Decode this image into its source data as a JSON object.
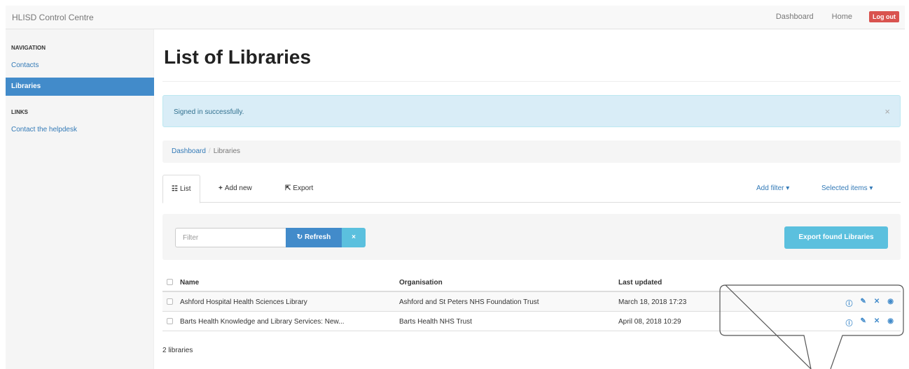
{
  "navbar": {
    "brand": "HLISD Control Centre",
    "links": [
      "Dashboard",
      "Home"
    ],
    "logout": "Log out"
  },
  "sidebar": {
    "navigation_heading": "NAVIGATION",
    "nav_items": [
      {
        "label": "Contacts",
        "active": false
      },
      {
        "label": "Libraries",
        "active": true
      }
    ],
    "links_heading": "LINKS",
    "link_items": [
      "Contact the helpdesk"
    ]
  },
  "page": {
    "title": "List of Libraries",
    "alert": "Signed in successfully.",
    "alert_close": "×"
  },
  "breadcrumb": {
    "root": "Dashboard",
    "separator": "/",
    "current": "Libraries"
  },
  "tabs": {
    "list": "List",
    "list_icon": "list-icon",
    "add_new": "Add new",
    "add_icon": "plus-icon",
    "export": "Export",
    "export_icon": "export-icon",
    "add_filter": "Add filter ▾",
    "selected_items": "Selected items ▾"
  },
  "filter": {
    "placeholder": "Filter",
    "refresh": "Refresh",
    "refresh_icon": "refresh-icon",
    "clear": "×",
    "export_button": "Export found Libraries"
  },
  "table": {
    "headers": [
      "Name",
      "Organisation",
      "Last updated"
    ],
    "rows": [
      {
        "name": "Ashford Hospital Health Sciences Library",
        "organisation": "Ashford and St Peters NHS Foundation Trust",
        "updated": "March 18, 2018 17:23"
      },
      {
        "name": "Barts Health Knowledge and Library Services: New...",
        "organisation": "Barts Health NHS Trust",
        "updated": "April 08, 2018 10:29"
      }
    ],
    "actions": [
      "info-icon",
      "edit-icon",
      "delete-icon",
      "view-icon"
    ],
    "count": "2 libraries"
  },
  "colors": {
    "primary": "#428bca",
    "info": "#5bc0de",
    "danger": "#d9534f",
    "alert_bg": "#d9edf7"
  }
}
